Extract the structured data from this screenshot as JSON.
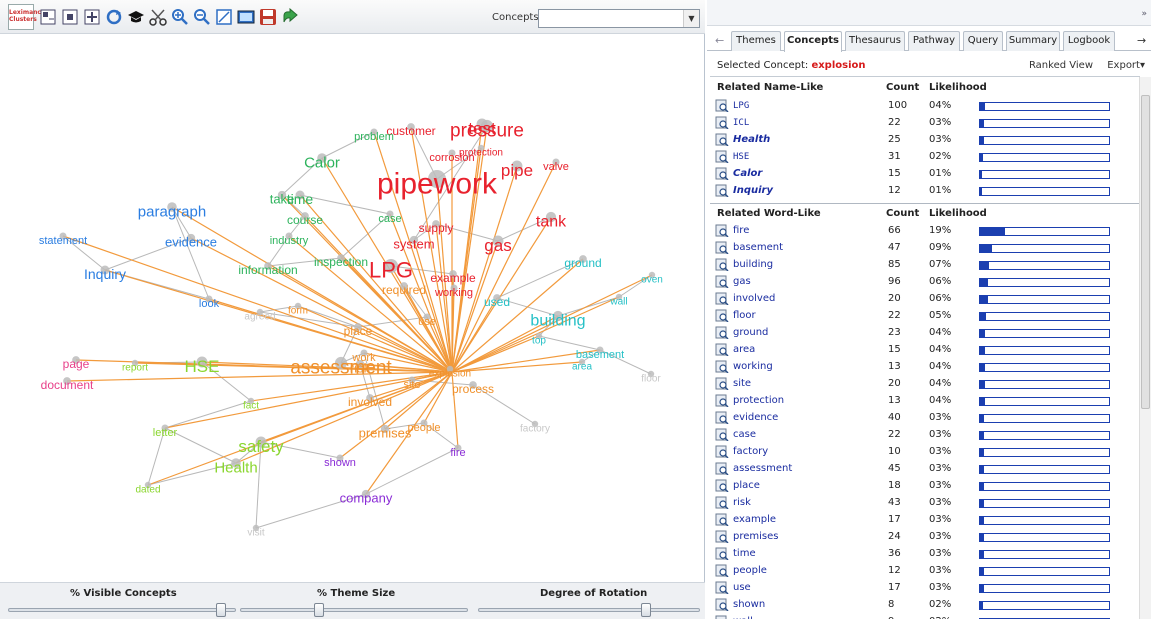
{
  "toolbar": {
    "logo_text": "Leximancer Clusters",
    "concepts_label": "Concepts:",
    "concepts_value": ""
  },
  "concept_map": {
    "center": "explosion",
    "concepts": [
      {
        "label": "pipework",
        "color": "#e8222e",
        "size": 30
      },
      {
        "label": "LPG",
        "color": "#e8222e",
        "size": 22
      },
      {
        "label": "pressure",
        "color": "#e8222e",
        "size": 19
      },
      {
        "label": "test",
        "color": "#e8222e",
        "size": 17
      },
      {
        "label": "pipe",
        "color": "#e8222e",
        "size": 17
      },
      {
        "label": "tank",
        "color": "#e8222e",
        "size": 16
      },
      {
        "label": "gas",
        "color": "#e8222e",
        "size": 17
      },
      {
        "label": "customer",
        "color": "#e8222e",
        "size": 12
      },
      {
        "label": "corrosion",
        "color": "#e8222e",
        "size": 11
      },
      {
        "label": "protection",
        "color": "#e8222e",
        "size": 10
      },
      {
        "label": "valve",
        "color": "#e8222e",
        "size": 11
      },
      {
        "label": "supply",
        "color": "#e8222e",
        "size": 12
      },
      {
        "label": "system",
        "color": "#e8222e",
        "size": 13
      },
      {
        "label": "example",
        "color": "#e8222e",
        "size": 12
      },
      {
        "label": "working",
        "color": "#e8222e",
        "size": 11
      },
      {
        "label": "problem",
        "color": "#2db35c",
        "size": 11
      },
      {
        "label": "Calor",
        "color": "#2db35c",
        "size": 15
      },
      {
        "label": "take",
        "color": "#2db35c",
        "size": 13
      },
      {
        "label": "time",
        "color": "#2db35c",
        "size": 14
      },
      {
        "label": "course",
        "color": "#2db35c",
        "size": 12
      },
      {
        "label": "case",
        "color": "#2db35c",
        "size": 11
      },
      {
        "label": "industry",
        "color": "#2db35c",
        "size": 11
      },
      {
        "label": "information",
        "color": "#2db35c",
        "size": 12
      },
      {
        "label": "inspection",
        "color": "#2db35c",
        "size": 12
      },
      {
        "label": "paragraph",
        "color": "#2a7de1",
        "size": 15
      },
      {
        "label": "evidence",
        "color": "#2a7de1",
        "size": 13
      },
      {
        "label": "statement",
        "color": "#2a7de1",
        "size": 11
      },
      {
        "label": "Inquiry",
        "color": "#2a7de1",
        "size": 14
      },
      {
        "label": "look",
        "color": "#2a7de1",
        "size": 11
      },
      {
        "label": "ground",
        "color": "#25c0c6",
        "size": 12
      },
      {
        "label": "oven",
        "color": "#25c0c6",
        "size": 10
      },
      {
        "label": "wall",
        "color": "#25c0c6",
        "size": 10
      },
      {
        "label": "used",
        "color": "#25c0c6",
        "size": 12
      },
      {
        "label": "building",
        "color": "#25c0c6",
        "size": 16
      },
      {
        "label": "top",
        "color": "#25c0c6",
        "size": 10
      },
      {
        "label": "basement",
        "color": "#25c0c6",
        "size": 11
      },
      {
        "label": "area",
        "color": "#25c0c6",
        "size": 10
      },
      {
        "label": "required",
        "color": "#f0902a",
        "size": 12
      },
      {
        "label": "form",
        "color": "#f0902a",
        "size": 10
      },
      {
        "label": "use",
        "color": "#f0902a",
        "size": 11
      },
      {
        "label": "place",
        "color": "#f0902a",
        "size": 12
      },
      {
        "label": "assessment",
        "color": "#f0902a",
        "size": 19
      },
      {
        "label": "work",
        "color": "#f0902a",
        "size": 11
      },
      {
        "label": "risk",
        "color": "#f0902a",
        "size": 13
      },
      {
        "label": "site",
        "color": "#f0902a",
        "size": 11
      },
      {
        "label": "explosion",
        "color": "#f0902a",
        "size": 10
      },
      {
        "label": "process",
        "color": "#f0902a",
        "size": 12
      },
      {
        "label": "involved",
        "color": "#f0902a",
        "size": 12
      },
      {
        "label": "premises",
        "color": "#f0902a",
        "size": 13
      },
      {
        "label": "people",
        "color": "#f0902a",
        "size": 11
      },
      {
        "label": "agreed",
        "color": "#c8c8c8",
        "size": 10
      },
      {
        "label": "floor",
        "color": "#c8c8c8",
        "size": 10
      },
      {
        "label": "factory",
        "color": "#c8c8c8",
        "size": 10
      },
      {
        "label": "visit",
        "color": "#c8c8c8",
        "size": 10
      },
      {
        "label": "page",
        "color": "#e8408a",
        "size": 12
      },
      {
        "label": "document",
        "color": "#e8408a",
        "size": 12
      },
      {
        "label": "report",
        "color": "#8ad62e",
        "size": 10
      },
      {
        "label": "HSE",
        "color": "#8ad62e",
        "size": 17
      },
      {
        "label": "fact",
        "color": "#8ad62e",
        "size": 10
      },
      {
        "label": "letter",
        "color": "#8ad62e",
        "size": 11
      },
      {
        "label": "safety",
        "color": "#8ad62e",
        "size": 17
      },
      {
        "label": "Health",
        "color": "#8ad62e",
        "size": 15
      },
      {
        "label": "dated",
        "color": "#8ad62e",
        "size": 10
      },
      {
        "label": "shown",
        "color": "#8a2cd6",
        "size": 11
      },
      {
        "label": "company",
        "color": "#8a2cd6",
        "size": 13
      },
      {
        "label": "fire",
        "color": "#8a2cd6",
        "size": 11
      }
    ]
  },
  "bottom": {
    "visible_concepts_label": "% Visible Concepts",
    "theme_size_label": "% Theme Size",
    "rotation_label": "Degree of Rotation",
    "visible_concepts_level": 0.96,
    "theme_size_level": 0.34,
    "rotation_level": 0.77
  },
  "tabs": [
    "Themes",
    "Concepts",
    "Thesaurus",
    "Pathway",
    "Query",
    "Summary",
    "Logbook"
  ],
  "active_tab": "Concepts",
  "selected": {
    "label": "Selected Concept:",
    "value": "explosion",
    "ranked_view": "Ranked View",
    "export": "Export▾"
  },
  "name_like": {
    "heading": "Related Name-Like",
    "count_header": "Count",
    "likelihood_header": "Likelihood",
    "rows": [
      {
        "name": "LPG",
        "count": "100",
        "likelihood": "04%",
        "pct": 4,
        "style": "mono"
      },
      {
        "name": "ICL",
        "count": "22",
        "likelihood": "03%",
        "pct": 3,
        "style": "mono"
      },
      {
        "name": "Health",
        "count": "25",
        "likelihood": "03%",
        "pct": 3,
        "style": "ital"
      },
      {
        "name": "HSE",
        "count": "31",
        "likelihood": "02%",
        "pct": 2,
        "style": "mono"
      },
      {
        "name": "Calor",
        "count": "15",
        "likelihood": "01%",
        "pct": 1,
        "style": "ital"
      },
      {
        "name": "Inquiry",
        "count": "12",
        "likelihood": "01%",
        "pct": 1,
        "style": "ital"
      }
    ]
  },
  "word_like": {
    "heading": "Related Word-Like",
    "count_header": "Count",
    "likelihood_header": "Likelihood",
    "rows": [
      {
        "name": "fire",
        "count": "66",
        "likelihood": "19%",
        "pct": 19
      },
      {
        "name": "basement",
        "count": "47",
        "likelihood": "09%",
        "pct": 9
      },
      {
        "name": "building",
        "count": "85",
        "likelihood": "07%",
        "pct": 7
      },
      {
        "name": "gas",
        "count": "96",
        "likelihood": "06%",
        "pct": 6
      },
      {
        "name": "involved",
        "count": "20",
        "likelihood": "06%",
        "pct": 6
      },
      {
        "name": "floor",
        "count": "22",
        "likelihood": "05%",
        "pct": 5
      },
      {
        "name": "ground",
        "count": "23",
        "likelihood": "04%",
        "pct": 4
      },
      {
        "name": "area",
        "count": "15",
        "likelihood": "04%",
        "pct": 4
      },
      {
        "name": "working",
        "count": "13",
        "likelihood": "04%",
        "pct": 4
      },
      {
        "name": "site",
        "count": "20",
        "likelihood": "04%",
        "pct": 4
      },
      {
        "name": "protection",
        "count": "13",
        "likelihood": "04%",
        "pct": 4
      },
      {
        "name": "evidence",
        "count": "40",
        "likelihood": "03%",
        "pct": 3
      },
      {
        "name": "case",
        "count": "22",
        "likelihood": "03%",
        "pct": 3
      },
      {
        "name": "factory",
        "count": "10",
        "likelihood": "03%",
        "pct": 3
      },
      {
        "name": "assessment",
        "count": "45",
        "likelihood": "03%",
        "pct": 3
      },
      {
        "name": "place",
        "count": "18",
        "likelihood": "03%",
        "pct": 3
      },
      {
        "name": "risk",
        "count": "43",
        "likelihood": "03%",
        "pct": 3
      },
      {
        "name": "example",
        "count": "17",
        "likelihood": "03%",
        "pct": 3
      },
      {
        "name": "premises",
        "count": "24",
        "likelihood": "03%",
        "pct": 3
      },
      {
        "name": "time",
        "count": "36",
        "likelihood": "03%",
        "pct": 3
      },
      {
        "name": "people",
        "count": "12",
        "likelihood": "03%",
        "pct": 3
      },
      {
        "name": "use",
        "count": "17",
        "likelihood": "03%",
        "pct": 3
      },
      {
        "name": "shown",
        "count": "8",
        "likelihood": "02%",
        "pct": 2
      },
      {
        "name": "wall",
        "count": "9",
        "likelihood": "02%",
        "pct": 2
      }
    ]
  }
}
